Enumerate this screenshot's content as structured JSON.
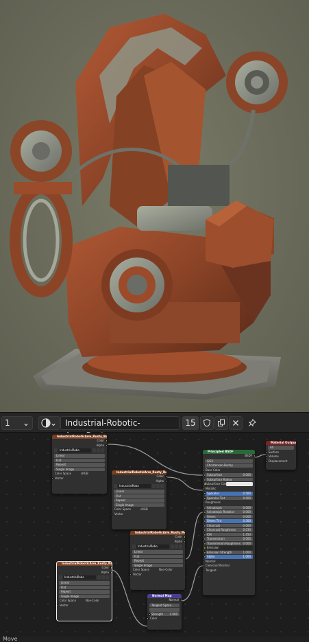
{
  "header": {
    "slot_value": "1",
    "material_name": "Industrial-Robotic-Arm_Rusty",
    "user_count": "15"
  },
  "icons": {
    "shading_ball": "sphere-icon",
    "shield": "fake-user-shield-icon",
    "copy": "duplicate-icon",
    "close": "close-icon",
    "pin": "pin-icon"
  },
  "colors": {
    "viewport_bg": "#6e6e5e",
    "editor_bg": "#1d1d1d",
    "texture_header": "#7a3f20",
    "shader_header": "#2a6a38",
    "vector_header": "#4b3d93",
    "output_header": "#7b2222",
    "link_color": "#9a9a9a"
  },
  "nodes": {
    "tex_basecolor": {
      "title": "IndustrialRoboticArm_Rusty_BaseColor",
      "out_color": "Color",
      "out_alpha": "Alpha",
      "image_name": "IndustrialRobo",
      "interp": "Linear",
      "proj": "Flat",
      "ext": "Repeat",
      "source": "Single Image",
      "colorspace_label": "Color Space",
      "colorspace_value": "sRGB",
      "vector": "Vector"
    },
    "tex_roughness": {
      "title": "IndustrialRoboticArm_Rusty_Roughness",
      "out_color": "Color",
      "out_alpha": "Alpha",
      "image_name": "IndustrialRobo",
      "interp": "Linear",
      "proj": "Flat",
      "ext": "Repeat",
      "source": "Single Image",
      "colorspace_label": "Color Space",
      "colorspace_value": "sRGB",
      "vector": "Vector"
    },
    "tex_metallic": {
      "title": "IndustrialRoboticArm_Rusty_Metallic",
      "out_color": "Color",
      "out_alpha": "Alpha",
      "image_name": "IndustrialRobo",
      "interp": "Linear",
      "proj": "Flat",
      "ext": "Repeat",
      "source": "Single Image",
      "colorspace_label": "Color Space",
      "colorspace_value": "Non-Color",
      "vector": "Vector"
    },
    "tex_normal": {
      "title": "IndustrialRoboticArm_Rusty_Normal",
      "out_color": "Color",
      "out_alpha": "Alpha",
      "image_name": "IndustrialRobo",
      "interp": "Linear",
      "proj": "Flat",
      "ext": "Repeat",
      "source": "Single Image",
      "colorspace_label": "Color Space",
      "colorspace_value": "Non-Color",
      "vector": "Vector"
    },
    "normal_map": {
      "title": "Normal Map",
      "out_normal": "Normal",
      "space": "Tangent Space",
      "strength_label": "Strength",
      "strength_value": "1.000",
      "color": "Color"
    },
    "bsdf": {
      "title": "Principled BSDF",
      "out_bsdf": "BSDF",
      "distribution": "GGX",
      "subsurface_method": "Christensen-Burley",
      "rows": [
        {
          "label": "Base Color",
          "value": "",
          "kind": "socket"
        },
        {
          "label": "Subsurface",
          "value": "0.000",
          "kind": "field"
        },
        {
          "label": "Subsurface Radius",
          "value": "",
          "kind": "field"
        },
        {
          "label": "Subsurface Color",
          "value": "",
          "kind": "color"
        },
        {
          "label": "Metallic",
          "value": "",
          "kind": "socket"
        },
        {
          "label": "Specular",
          "value": "0.500",
          "kind": "blue"
        },
        {
          "label": "Specular Tint",
          "value": "0.000",
          "kind": "field"
        },
        {
          "label": "Roughness",
          "value": "",
          "kind": "socket"
        },
        {
          "label": "Anisotropic",
          "value": "0.000",
          "kind": "field"
        },
        {
          "label": "Anisotropic Rotation",
          "value": "0.000",
          "kind": "field"
        },
        {
          "label": "Sheen",
          "value": "0.000",
          "kind": "field"
        },
        {
          "label": "Sheen Tint",
          "value": "0.500",
          "kind": "blue"
        },
        {
          "label": "Clearcoat",
          "value": "0.000",
          "kind": "field"
        },
        {
          "label": "Clearcoat Roughness",
          "value": "0.030",
          "kind": "field"
        },
        {
          "label": "IOR",
          "value": "1.450",
          "kind": "field"
        },
        {
          "label": "Transmission",
          "value": "0.000",
          "kind": "field"
        },
        {
          "label": "Transmission Roughness",
          "value": "0.000",
          "kind": "field"
        },
        {
          "label": "Emission",
          "value": "",
          "kind": "dark"
        },
        {
          "label": "Emission Strength",
          "value": "1.000",
          "kind": "field"
        },
        {
          "label": "Alpha",
          "value": "1.000",
          "kind": "blue"
        },
        {
          "label": "Normal",
          "value": "",
          "kind": "socket"
        },
        {
          "label": "Clearcoat Normal",
          "value": "",
          "kind": "socket"
        },
        {
          "label": "Tangent",
          "value": "",
          "kind": "socket"
        }
      ]
    },
    "output": {
      "title": "Material Output",
      "target": "All",
      "in_surface": "Surface",
      "in_volume": "Volume",
      "in_displacement": "Displacement"
    }
  },
  "status": {
    "text": "Move"
  }
}
